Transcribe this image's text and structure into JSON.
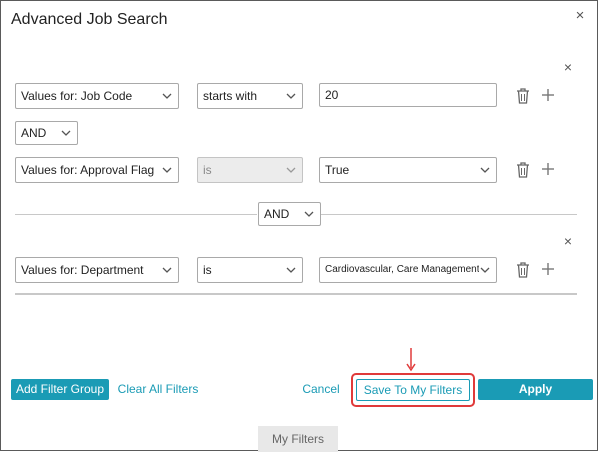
{
  "dialog": {
    "title": "Advanced Job Search",
    "close_icon": "×"
  },
  "group1": {
    "close_icon": "×",
    "row1": {
      "field": "Values for:  Job Code",
      "operator": "starts with",
      "value": "20"
    },
    "connector": "AND",
    "row2": {
      "field": "Values for:  Approval Flag",
      "operator": "is",
      "value": "True"
    }
  },
  "group_connector": "AND",
  "group2": {
    "close_icon": "×",
    "row1": {
      "field": "Values for:  Department",
      "operator": "is",
      "value": "Cardiovascular, Care Management, C"
    }
  },
  "footer": {
    "add_filter_group": "Add Filter Group",
    "clear_all": "Clear All Filters",
    "cancel": "Cancel",
    "save_to_my_filters": "Save To My Filters",
    "apply": "Apply"
  },
  "tabs": {
    "my_filters": "My Filters"
  },
  "colors": {
    "accent": "#1a9bb5",
    "highlight": "#e03a3a"
  }
}
